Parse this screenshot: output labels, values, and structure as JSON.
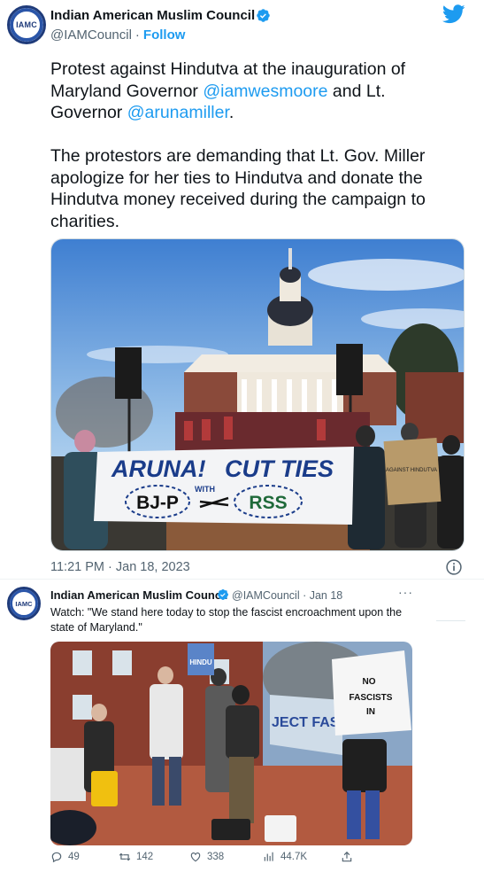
{
  "tweet": {
    "author_name": "Indian American Muslim Council",
    "handle": "@IAMCouncil",
    "separator": "·",
    "follow_label": "Follow",
    "avatar_text": "IAMC",
    "text_part1": "Protest against Hindutva at the inauguration of Maryland Governor ",
    "mention1": "@iamwesmoore",
    "text_part2": "  and Lt. Governor ",
    "mention2": "@arunamiller",
    "text_part3": ".",
    "paragraph2": "The protestors are demanding that Lt. Gov. Miller apologize for her ties to Hindutva and donate the Hindutva money received during the campaign to charities.",
    "timestamp": "11:21 PM · Jan 18, 2023",
    "photo": {
      "banner_line1": "ARUNA!",
      "banner_with": "WITH",
      "banner_cut_ties": "CUT  TIES",
      "banner_bjp": "BJ-P",
      "banner_rss": "RSS",
      "sign_text": "AGAINST HINDUTVA"
    }
  },
  "quoted_tweet": {
    "author_name": "Indian American Muslim Council",
    "avatar_text": "IAMC",
    "meta": "@IAMCouncil · Jan 18",
    "more_label": "···",
    "text": "Watch: \"We stand here today to stop the fascist encroachment upon the state of Maryland.\"",
    "video": {
      "sign1": "NO",
      "sign2": "FASCISTS",
      "sign3": "IN",
      "banner": "JECT FASCI",
      "left_sign": "HINDU"
    },
    "actions": {
      "replies": "49",
      "retweets": "142",
      "likes": "338",
      "views": "44.7K"
    }
  },
  "colors": {
    "accent": "#1d9bf0",
    "text_secondary": "#536471"
  }
}
